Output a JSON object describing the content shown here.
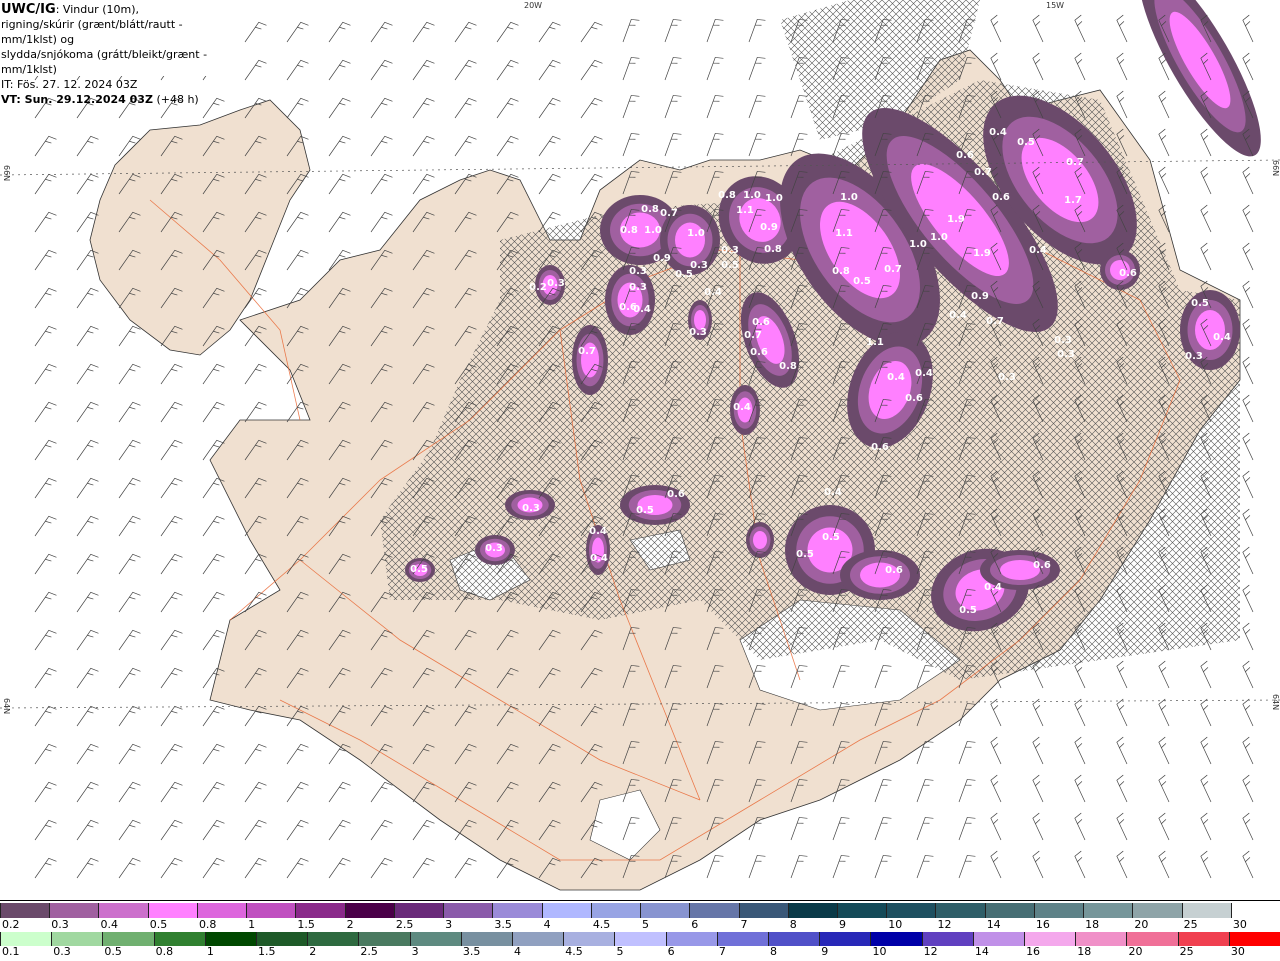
{
  "header": {
    "product": "UWC/IG",
    "line1_rest": ": Vindur (10m),",
    "line2": "rigning/skúrir (grænt/blátt/rautt - mm/1klst) og",
    "line3": "slydda/snjókoma (grátt/bleikt/grænt - mm/1klst)",
    "issue_time": "IT: Fös. 27. 12. 2024 03Z",
    "valid_time": "VT: Sun. 29.12.2024 03Z",
    "lead": "(+48 h)"
  },
  "grid_labels": {
    "lon_20w": "20W",
    "lon_15w": "15W",
    "lat_66n_left": "66N",
    "lat_64n_left": "64N",
    "lat_66n_right": "66N",
    "lat_64n_right": "64N"
  },
  "precip_labels": [
    "0.8",
    "0.7",
    "0.8",
    "1.0",
    "1.0",
    "0.9",
    "0.3",
    "0.3",
    "0.5",
    "0.6",
    "0.4",
    "0.3",
    "0.2",
    "0.3",
    "0.7",
    "0.8",
    "1.0",
    "1.1",
    "1.0",
    "0.9",
    "0.8",
    "0.3",
    "0.5",
    "0.4",
    "0.3",
    "0.6",
    "0.7",
    "0.6",
    "0.8",
    "0.4",
    "1.0",
    "1.1",
    "0.8",
    "0.5",
    "0.7",
    "1.0",
    "1.0",
    "1.9",
    "1.9",
    "0.9",
    "0.7",
    "0.4",
    "0.6",
    "0.7",
    "0.6",
    "0.4",
    "0.5",
    "0.7",
    "1.7",
    "0.4",
    "0.3",
    "0.3",
    "0.3",
    "0.6",
    "0.5",
    "0.4",
    "0.3",
    "1.1",
    "0.4",
    "0.4",
    "0.6",
    "0.6",
    "0.5",
    "0.6",
    "0.3",
    "0.3",
    "0.5",
    "0.4",
    "0.4",
    "0.5",
    "0.4",
    "0.5",
    "0.6",
    "0.4",
    "0.6",
    "0.5"
  ],
  "legend_snow": {
    "labels": [
      "0.2",
      "0.3",
      "0.4",
      "0.5",
      "0.8",
      "1",
      "1.5",
      "2",
      "2.5",
      "3",
      "3.5",
      "4",
      "4.5",
      "5",
      "6",
      "7",
      "8",
      "9",
      "10",
      "12",
      "14",
      "16",
      "18",
      "20",
      "25",
      "30"
    ],
    "colors": [
      "#6b4a6b",
      "#a060a0",
      "#cc70cc",
      "#ff80ff",
      "#dd66dd",
      "#c050c0",
      "#8a2a8a",
      "#4a0048",
      "#6a2a7a",
      "#8a5aaa",
      "#9a8ad8",
      "#b0b8ff",
      "#98a4e4",
      "#8894d0",
      "#6676a8",
      "#3a5878",
      "#0a3a48",
      "#144a58",
      "#1e5060",
      "#2e5e68",
      "#466e74",
      "#5e8288",
      "#76969a",
      "#8ea4a8",
      "#c6d0d2",
      "#ffffff"
    ]
  },
  "legend_rain": {
    "labels": [
      "0.1",
      "0.3",
      "0.5",
      "0.8",
      "1",
      "1.5",
      "2",
      "2.5",
      "3",
      "3.5",
      "4",
      "4.5",
      "5",
      "6",
      "7",
      "8",
      "9",
      "10",
      "12",
      "14",
      "16",
      "18",
      "20",
      "25",
      "30"
    ],
    "colors": [
      "#ccffcc",
      "#a0d8a0",
      "#70b070",
      "#308030",
      "#004800",
      "#1e5a28",
      "#2e6a40",
      "#4a7a60",
      "#5e8a80",
      "#7890a0",
      "#90a0c0",
      "#a8b0e0",
      "#c0c0ff",
      "#9898e8",
      "#7070d8",
      "#5050c8",
      "#2828b8",
      "#0000a8",
      "#6040c0",
      "#c090e8",
      "#f4a8ec",
      "#f090c8",
      "#f07098",
      "#f04050",
      "#ff0000"
    ]
  },
  "colors": {
    "land": "#f0e0d0",
    "roads": "#e8602a",
    "sea": "#ffffff",
    "hatch": "#555555"
  }
}
